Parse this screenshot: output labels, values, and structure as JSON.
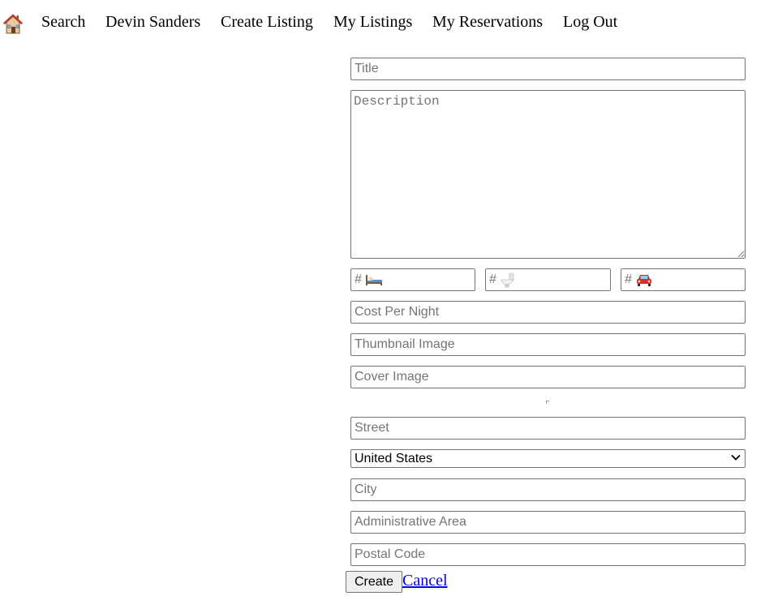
{
  "nav": {
    "home_icon": "house-icon",
    "items": [
      {
        "label": "Search"
      },
      {
        "label": "Devin Sanders"
      },
      {
        "label": "Create Listing"
      },
      {
        "label": "My Listings"
      },
      {
        "label": "My Reservations"
      },
      {
        "label": "Log Out"
      }
    ]
  },
  "form": {
    "title_placeholder": "Title",
    "description_placeholder": "Description",
    "counts": [
      {
        "prefix": "#",
        "icon": "bed-icon",
        "value": ""
      },
      {
        "prefix": "#",
        "icon": "toilet-icon",
        "value": ""
      },
      {
        "prefix": "#",
        "icon": "car-icon",
        "value": ""
      }
    ],
    "cost_placeholder": "Cost Per Night",
    "thumbnail_placeholder": "Thumbnail Image",
    "cover_placeholder": "Cover Image",
    "street_placeholder": "Street",
    "country_selected": "United States",
    "city_placeholder": "City",
    "admin_area_placeholder": "Administrative Area",
    "postal_placeholder": "Postal Code",
    "create_label": "Create",
    "cancel_label": "Cancel"
  },
  "colors": {
    "link": "#0000ee",
    "border": "#767676",
    "placeholder": "#757575",
    "button_bg": "#efefef"
  }
}
